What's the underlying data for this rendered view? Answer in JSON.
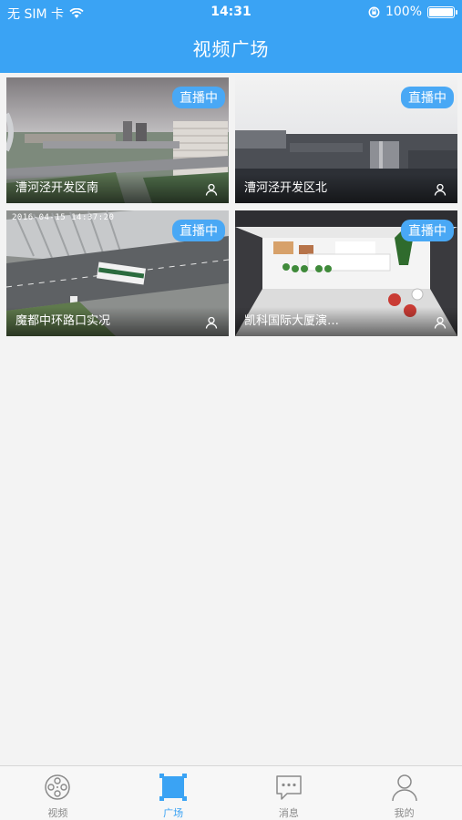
{
  "status_bar": {
    "carrier": "无 SIM 卡",
    "time": "14:31",
    "battery": "100%",
    "battery_level": 1.0,
    "icons": [
      "wifi-icon",
      "orientation-lock-icon",
      "battery-icon"
    ]
  },
  "header": {
    "title": "视频广场"
  },
  "tiles": [
    {
      "badge": "直播中",
      "name": "漕河泾开发区南",
      "timestamp": ""
    },
    {
      "badge": "直播中",
      "name": "漕河泾开发区北",
      "timestamp": ""
    },
    {
      "badge": "直播中",
      "name": "魔都中环路口实况",
      "timestamp": "2016-04-15 14:37:20"
    },
    {
      "badge": "直播中",
      "name": "凯科国际大厦演…",
      "timestamp": ""
    }
  ],
  "tabbar": {
    "items": [
      {
        "label": "视频",
        "icon": "film-reel-icon"
      },
      {
        "label": "广场",
        "icon": "plaza-square-icon"
      },
      {
        "label": "消息",
        "icon": "chat-bubble-icon"
      },
      {
        "label": "我的",
        "icon": "person-icon"
      }
    ],
    "active_index": 1
  },
  "colors": {
    "accent": "#3aa3f4",
    "badge": "#49a8f5",
    "tab_inactive": "#8a8a8a"
  }
}
